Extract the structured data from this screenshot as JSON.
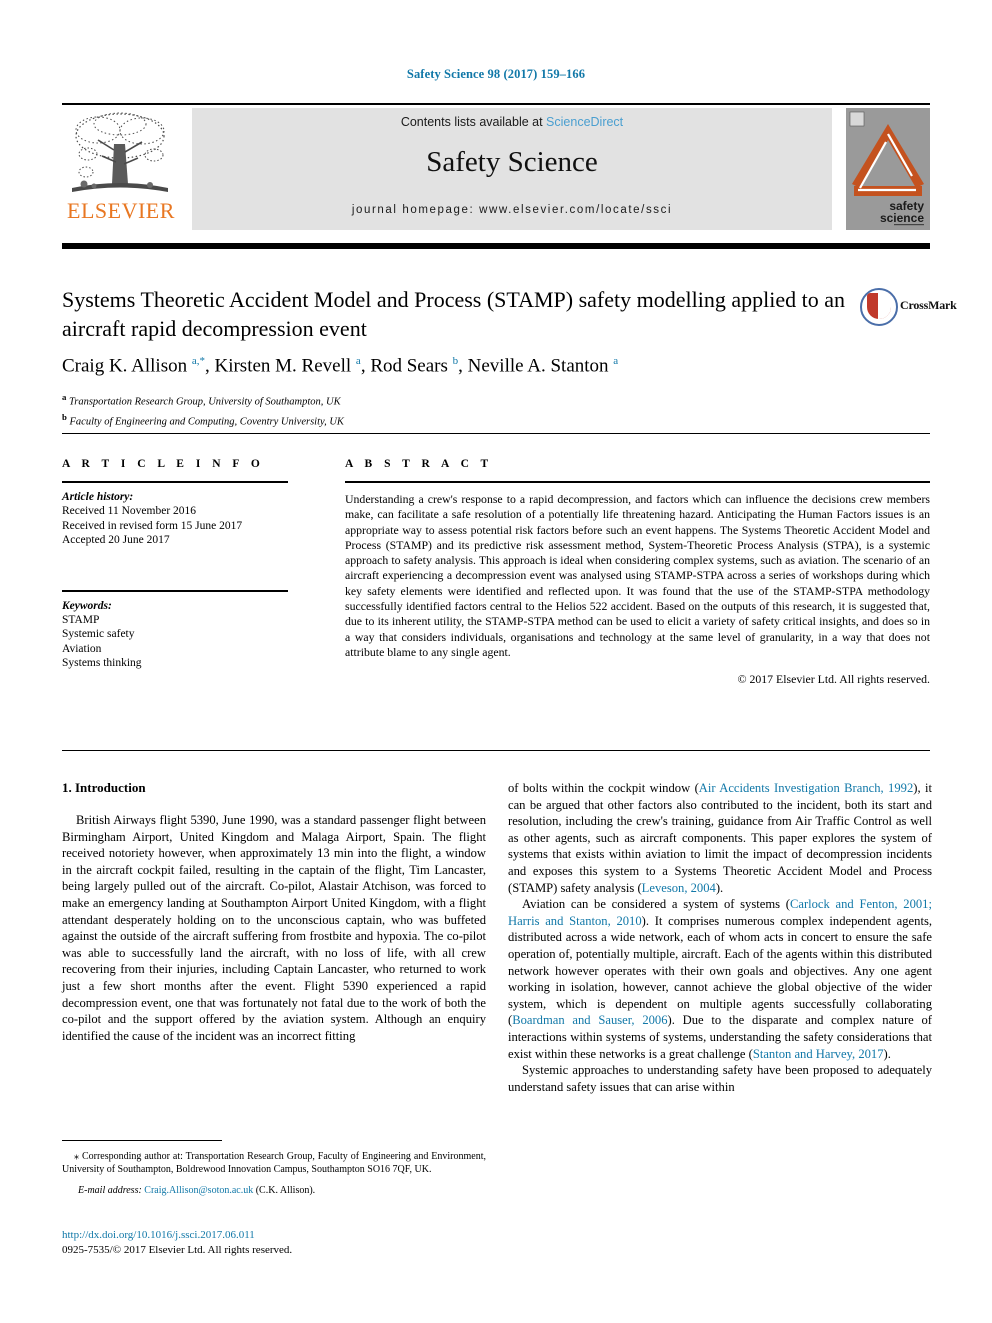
{
  "running_head": "Safety Science 98 (2017) 159–166",
  "masthead": {
    "contents_prefix": "Contents lists available at ",
    "sciencedirect_link": "ScienceDirect",
    "journal_title": "Safety Science",
    "homepage": "journal homepage: www.elsevier.com/locate/ssci",
    "publisher_logo_text": "ELSEVIER",
    "cover_title_line1": "safety",
    "cover_title_line2": "science"
  },
  "article": {
    "title": "Systems Theoretic Accident Model and Process (STAMP) safety modelling applied to an aircraft rapid decompression event",
    "crossmark_label": "CrossMark",
    "authors_html": "Craig K. Allison <sup>a,*</sup>, Kirsten M. Revell <sup>a</sup>, Rod Sears <sup>b</sup>, Neville A. Stanton <sup>a</sup>",
    "affiliation_a": "Transportation Research Group, University of Southampton, UK",
    "affiliation_b": "Faculty of Engineering and Computing, Coventry University, UK"
  },
  "article_info": {
    "heading": "A R T I C L E   I N F O",
    "history_label": "Article history:",
    "history": [
      "Received 11 November 2016",
      "Received in revised form 15 June 2017",
      "Accepted 20 June 2017"
    ],
    "keywords_label": "Keywords:",
    "keywords": [
      "STAMP",
      "Systemic safety",
      "Aviation",
      "Systems thinking"
    ]
  },
  "abstract": {
    "heading": "A B S T R A C T",
    "text": "Understanding a crew's response to a rapid decompression, and factors which can influence the decisions crew members make, can facilitate a safe resolution of a potentially life threatening hazard. Anticipating the Human Factors issues is an appropriate way to assess potential risk factors before such an event happens. The Systems Theoretic Accident Model and Process (STAMP) and its predictive risk assessment method, System-Theoretic Process Analysis (STPA), is a systemic approach to safety analysis. This approach is ideal when considering complex systems, such as aviation. The scenario of an aircraft experiencing a decompression event was analysed using STAMP-STPA across a series of workshops during which key safety elements were identified and reflected upon. It was found that the use of the STAMP-STPA methodology successfully identified factors central to the Helios 522 accident. Based on the outputs of this research, it is suggested that, due to its inherent utility, the STAMP-STPA method can be used to elicit a variety of safety critical insights, and does so in a way that considers individuals, organisations and technology at the same level of granularity, in a way that does not attribute blame to any single agent.",
    "copyright": "© 2017 Elsevier Ltd. All rights reserved."
  },
  "body": {
    "section_heading": "1. Introduction",
    "left_paragraph_1": "British Airways flight 5390, June 1990, was a standard passenger flight between Birmingham Airport, United Kingdom and Malaga Airport, Spain. The flight received notoriety however, when approximately 13 min into the flight, a window in the aircraft cockpit failed, resulting in the captain of the flight, Tim Lancaster, being largely pulled out of the aircraft. Co-pilot, Alastair Atchison, was forced to make an emergency landing at Southampton Airport United Kingdom, with a flight attendant desperately holding on to the unconscious captain, who was buffeted against the outside of the aircraft suffering from frostbite and hypoxia. The co-pilot was able to successfully land the aircraft, with no loss of life, with all crew recovering from their injuries, including Captain Lancaster, who returned to work just a few short months after the event. Flight 5390 experienced a rapid decompression event, one that was fortunately not fatal due to the work of both the co-pilot and the support offered by the aviation system. Although an enquiry identified the cause of the incident was an incorrect fitting",
    "right_paragraph_1_part1": "of bolts within the cockpit window (",
    "right_paragraph_1_cite1": "Air Accidents Investigation Branch, 1992",
    "right_paragraph_1_part2": "), it can be argued that other factors also contributed to the incident, both its start and resolution, including the crew's training, guidance from Air Traffic Control as well as other agents, such as aircraft components. This paper explores the system of systems that exists within aviation to limit the impact of decompression incidents and exposes this system to a Systems Theoretic Accident Model and Process (STAMP) safety analysis (",
    "right_paragraph_1_cite2": "Leveson, 2004",
    "right_paragraph_1_part3": ").",
    "right_paragraph_2_part1": "Aviation can be considered a system of systems (",
    "right_paragraph_2_cite1": "Carlock and Fenton, 2001; Harris and Stanton, 2010",
    "right_paragraph_2_part2": "). It comprises numerous complex independent agents, distributed across a wide network, each of whom acts in concert to ensure the safe operation of, potentially multiple, aircraft. Each of the agents within this distributed network however operates with their own goals and objectives. Any one agent working in isolation, however, cannot achieve the global objective of the wider system, which is dependent on multiple agents successfully collaborating (",
    "right_paragraph_2_cite2": "Boardman and Sauser, 2006",
    "right_paragraph_2_part3": "). Due to the disparate and complex nature of interactions within systems of systems, understanding the safety considerations that exist within these networks is a great challenge (",
    "right_paragraph_2_cite3": "Stanton and Harvey, 2017",
    "right_paragraph_2_part4": ").",
    "right_paragraph_3": "Systemic approaches to understanding safety have been proposed to adequately understand safety issues that can arise within"
  },
  "footnote": {
    "marker": "⁎",
    "corresponding": "Corresponding author at: Transportation Research Group, Faculty of Engineering and Environment, University of Southampton, Boldrewood Innovation Campus, Southampton SO16 7QF, UK.",
    "email_label": "E-mail address:",
    "email": "Craig.Allison@soton.ac.uk",
    "email_suffix": "(C.K. Allison)."
  },
  "footer": {
    "doi": "http://dx.doi.org/10.1016/j.ssci.2017.06.011",
    "issn_line": "0925-7535/© 2017 Elsevier Ltd. All rights reserved."
  },
  "colors": {
    "link_blue": "#1178a8",
    "sciencedirect_blue": "#4a9fd0",
    "elsevier_orange": "#e87722",
    "banner_gray": "#e2e2e2",
    "cover_gray": "#9a9a9a",
    "crossmark_red": "#c0392b",
    "crossmark_blue": "#4a6ea9"
  }
}
